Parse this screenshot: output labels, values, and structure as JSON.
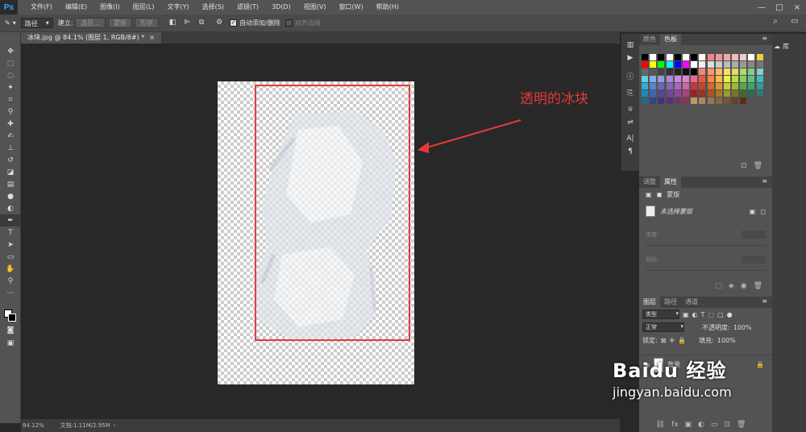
{
  "app": {
    "logo": "Ps"
  },
  "menu": [
    "文件(F)",
    "编辑(E)",
    "图像(I)",
    "图层(L)",
    "文字(Y)",
    "选择(S)",
    "滤镜(T)",
    "3D(D)",
    "视图(V)",
    "窗口(W)",
    "帮助(H)"
  ],
  "options": {
    "mode": "路径",
    "build_label": "建立:",
    "btn_selection": "选区...",
    "btn_mask": "蒙版",
    "btn_shape": "形状",
    "auto_add_delete": "自动添加/删除",
    "align_edges": "对齐边缘"
  },
  "document": {
    "tab_title": "冰块.jpg @ 84.1% (图层 1, RGB/8#) *",
    "tab_close": "×"
  },
  "annotation": "透明的冰块",
  "status": {
    "zoom": "84.12%",
    "doc_info": "文档:1.11M/2.95M"
  },
  "swatch_panel": {
    "tab_color": "颜色",
    "tab_swatches": "色板"
  },
  "properties_panel": {
    "tab_adjust": "调整",
    "tab_props": "属性",
    "mask_label": "蒙版",
    "no_mask": "未选择蒙版",
    "density_label": "浓度:",
    "feather_label": "羽化:"
  },
  "layers_panel": {
    "tab_layers": "图层",
    "tab_paths": "路径",
    "tab_channels": "通道",
    "kind": "类型",
    "blend": "正常",
    "opacity_label": "不透明度:",
    "opacity_value": "100%",
    "lock_label": "锁定:",
    "fill_label": "填充:",
    "fill_value": "100%",
    "layer_bg": "背景"
  },
  "library": {
    "label": "库"
  },
  "watermark": {
    "line1": "Baidu 经验",
    "line2": "jingyan.baidu.com"
  },
  "colors": {
    "accent": "#e53a3a"
  }
}
